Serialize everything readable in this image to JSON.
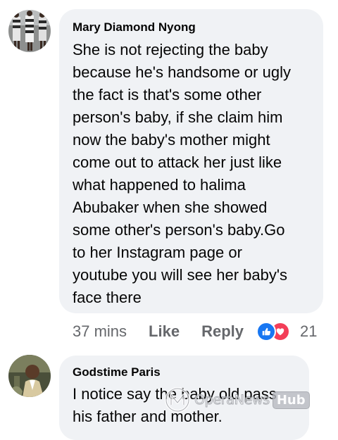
{
  "comments": [
    {
      "author": "Mary Diamond Nyong",
      "lines": [
        "She is not rejecting the baby",
        "because he's handsome or ugly",
        "the fact is that's some other",
        "person's baby, if she claim him",
        "now the baby's mother might",
        "come out to attack her just like",
        "what happened to halima",
        "Abubaker when she showed",
        "some other's person's baby.Go",
        "to her Instagram page or",
        "youtube you will see her baby's",
        "face there"
      ],
      "time": "37 mins",
      "like_label": "Like",
      "reply_label": "Reply",
      "reaction_icons": [
        "like-icon",
        "love-icon"
      ],
      "reaction_count": "21"
    },
    {
      "author": "Godstime Paris",
      "lines": [
        "I notice say the baby old pass",
        "his father and mother."
      ]
    }
  ],
  "watermark": {
    "brand": "OperaNews",
    "hub": "Hub"
  },
  "colors": {
    "bubble": "#f0f2f5",
    "text": "#050505",
    "meta": "#65676b",
    "like_blue": "#1877f2",
    "love_red": "#f33e58"
  }
}
